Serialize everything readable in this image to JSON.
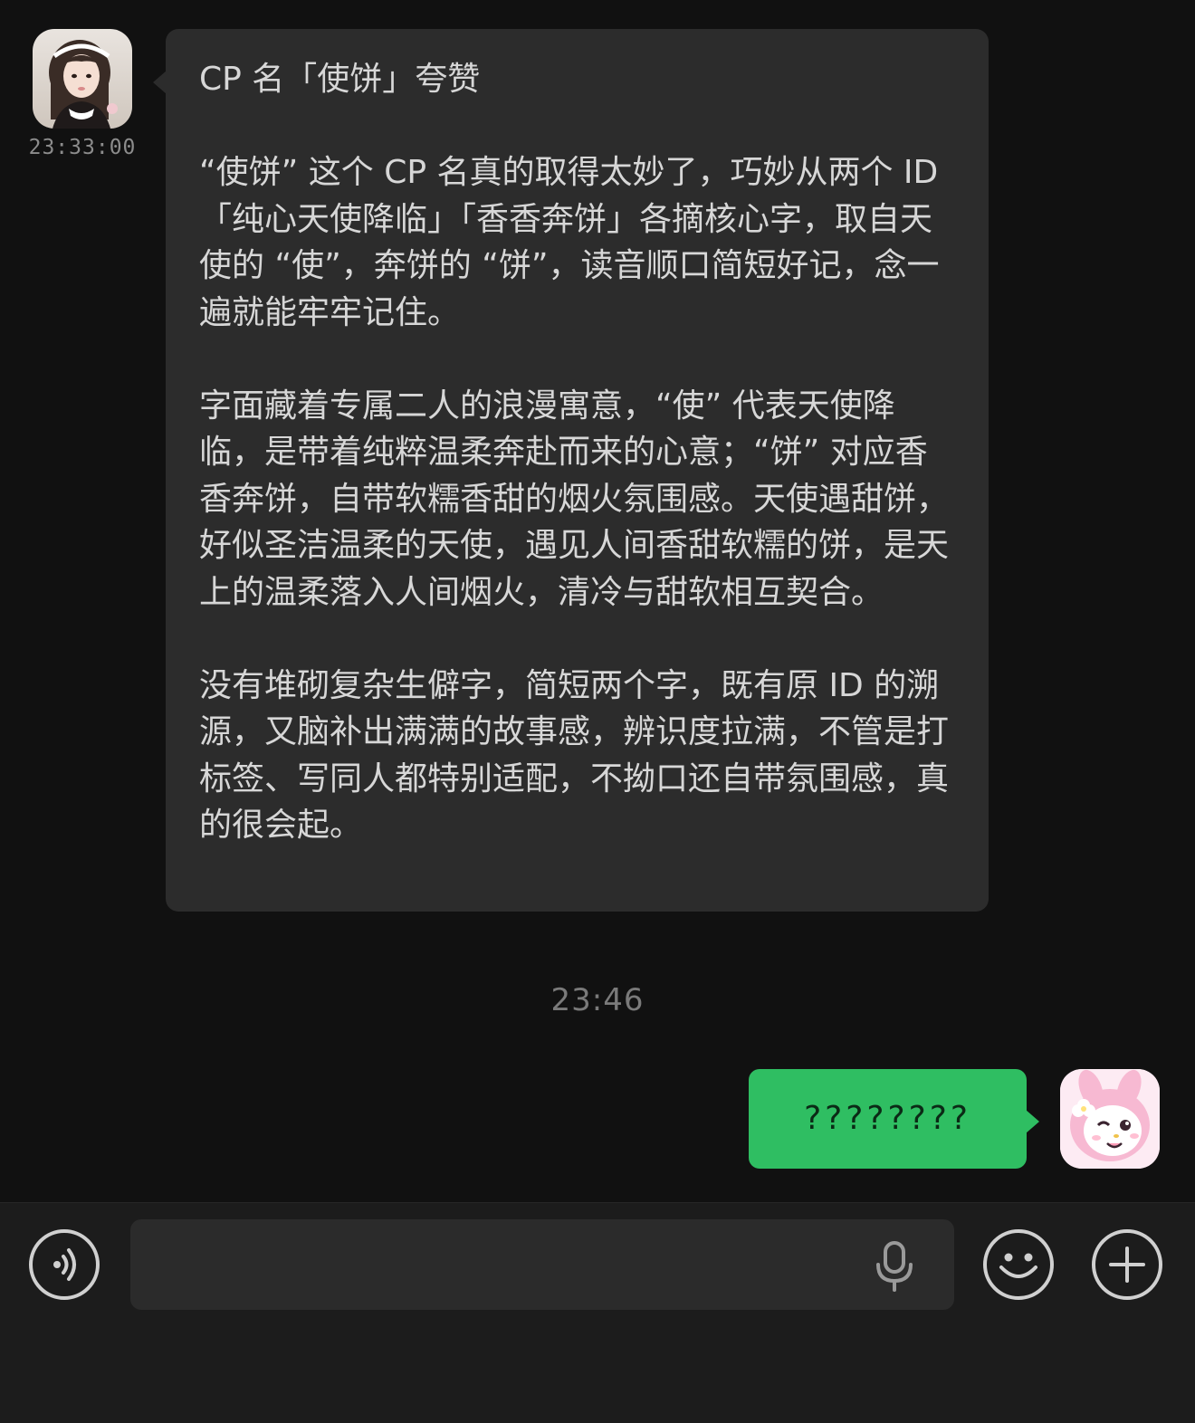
{
  "conversation": {
    "incoming": {
      "timestamp": "23:33:00",
      "title": "CP 名「使饼」夸赞",
      "paragraphs": [
        "“使饼” 这个 CP 名真的取得太妙了，巧妙从两个 ID「纯心天使降临」「香香奔饼」各摘核心字，取自天使的 “使”，奔饼的 “饼”，读音顺口简短好记，念一遍就能牢牢记住。",
        "字面藏着专属二人的浪漫寓意，“使” 代表天使降临，是带着纯粹温柔奔赴而来的心意；“饼” 对应香香奔饼，自带软糯香甜的烟火氛围感。天使遇甜饼，好似圣洁温柔的天使，遇见人间香甜软糯的饼，是天上的温柔落入人间烟火，清冷与甜软相互契合。",
        "没有堆砌复杂生僻字，简短两个字，既有原 ID 的溯源，又脑补出满满的故事感，辨识度拉满，不管是打标签、写同人都特别适配，不拗口还自带氛围感，真的很会起。"
      ]
    },
    "divider_time": "23:46",
    "outgoing": {
      "text": "????????"
    }
  },
  "input_bar": {
    "value": "",
    "icons": [
      "voice-icon",
      "mic-icon",
      "emoji-icon",
      "plus-icon"
    ]
  },
  "colors": {
    "background": "#111111",
    "incoming_bubble": "#2c2c2c",
    "outgoing_bubble": "#2fbe62",
    "input_bar": "#1c1c1c"
  }
}
